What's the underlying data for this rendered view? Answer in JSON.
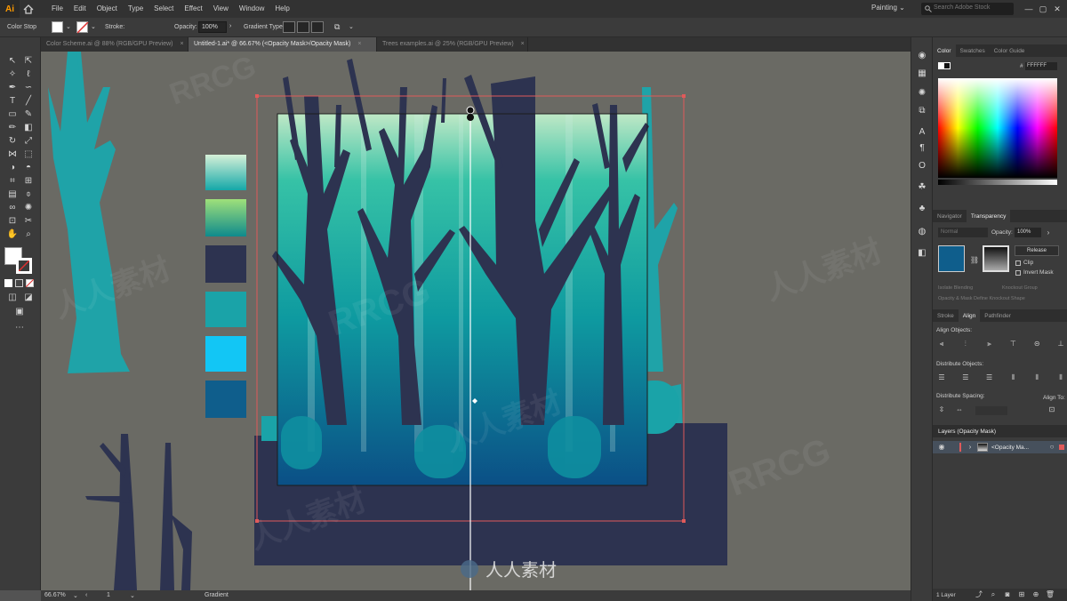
{
  "app": {
    "logo": "Ai"
  },
  "menu": [
    "File",
    "Edit",
    "Object",
    "Type",
    "Select",
    "Effect",
    "View",
    "Window",
    "Help"
  ],
  "workspace": "Painting",
  "search_placeholder": "Search Adobe Stock",
  "control_bar": {
    "selection": "Color Stop",
    "stroke_label": "Stroke:",
    "opacity_label": "Opacity:",
    "opacity_value": "100%",
    "gradient_type_label": "Gradient Type:"
  },
  "tabs": [
    {
      "label": "Color Scheme.ai @ 88% (RGB/GPU Preview)",
      "close": "×"
    },
    {
      "label": "Untitled-1.ai* @ 66.67% (<Opacity Mask>/Opacity Mask)",
      "close": "×"
    },
    {
      "label": "Trees examples.ai @ 25% (RGB/GPU Preview)",
      "close": "×"
    }
  ],
  "swatches": [
    "#1fb3b3",
    "#4fc98a",
    "#2d3350",
    "#1aa3a8",
    "#12c6f5",
    "#0f5e8c"
  ],
  "status": {
    "zoom": "66.67%",
    "artboard": "1",
    "tool": "Gradient"
  },
  "color_panel": {
    "tabs": [
      "Color",
      "Swatches",
      "Color Guide"
    ],
    "hex_label": "#",
    "hex_value": "FFFFFF"
  },
  "transparency_panel": {
    "tabs": [
      "Navigator",
      "Transparency"
    ],
    "blend_mode": "Normal",
    "opacity_label": "Opacity:",
    "opacity_value": "100%",
    "release_button": "Release",
    "clip_label": "Clip",
    "invert_mask_label": "Invert Mask",
    "isolate_label": "Isolate Blending",
    "knockout_label": "Knockout Group",
    "opacity_mask_label": "Opacity & Mask Define Knockout Shape"
  },
  "align_panel": {
    "tabs": [
      "Stroke",
      "Align",
      "Pathfinder"
    ],
    "align_objects": "Align Objects:",
    "distribute_objects": "Distribute Objects:",
    "distribute_spacing": "Distribute Spacing:",
    "align_to": "Align To:"
  },
  "layers_panel": {
    "title": "Layers (Opacity Mask)",
    "row_label": "<Opacity Ma...",
    "count": "1 Layer"
  },
  "watermarks": [
    "RRCG",
    "人人素材"
  ]
}
